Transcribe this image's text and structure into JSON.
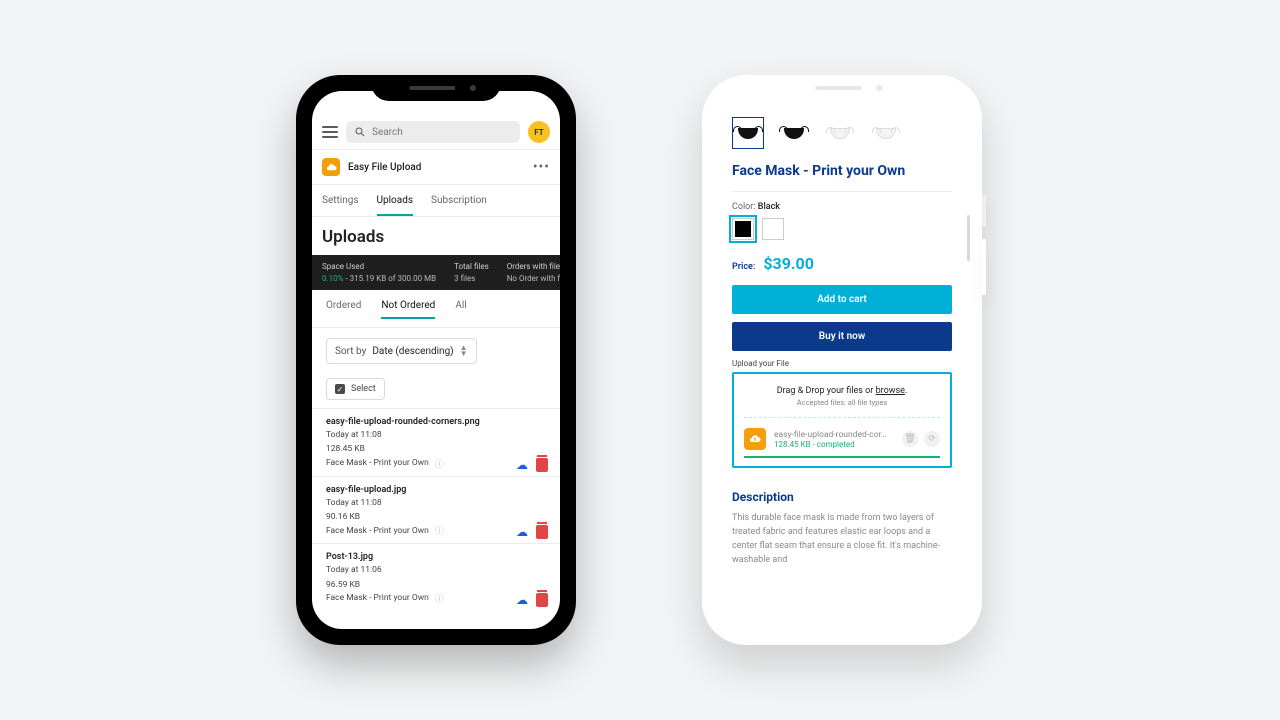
{
  "left": {
    "search_placeholder": "Search",
    "avatar_initials": "FT",
    "app_name": "Easy File Upload",
    "tabs": [
      "Settings",
      "Uploads",
      "Subscription"
    ],
    "active_tab": "Uploads",
    "page_heading": "Uploads",
    "stats": {
      "space_label": "Space Used",
      "space_pct": "0.10%",
      "space_sep": " - ",
      "space_detail": "315.19 KB of 300.00 MB",
      "files_label": "Total files",
      "files_value": "3 files",
      "orders_label": "Orders with files",
      "orders_value": "No Order with files yet"
    },
    "subtabs": [
      "Ordered",
      "Not Ordered",
      "All"
    ],
    "active_subtab": "Not Ordered",
    "sort_prefix": "Sort by ",
    "sort_value": "Date (descending)",
    "select_button": "Select",
    "files": [
      {
        "name": "easy-file-upload-rounded-corners.png",
        "when": "Today at 11:08",
        "size": "128.45 KB",
        "product": "Face Mask - Print your Own"
      },
      {
        "name": "easy-file-upload.jpg",
        "when": "Today at 11:08",
        "size": "90.16 KB",
        "product": "Face Mask - Print your Own"
      },
      {
        "name": "Post-13.jpg",
        "when": "Today at 11:06",
        "size": "96.59 KB",
        "product": "Face Mask - Print your Own"
      }
    ]
  },
  "right": {
    "product_title": "Face Mask - Print your Own",
    "color_label": "Color:",
    "color_value": "Black",
    "price_label": "Price:",
    "price_value": "$39.00",
    "add_to_cart": "Add to cart",
    "buy_now": "Buy it now",
    "upload_label": "Upload your File",
    "drop_text_a": "Drag & Drop your files or ",
    "drop_text_b": "browse",
    "drop_text_c": ".",
    "accepted_text": "Accepted files: all file types",
    "uploaded": {
      "name": "easy-file-upload-rounded-cor…",
      "status": "128.45 KB - completed"
    },
    "description_heading": "Description",
    "description_body": "This durable face mask is made from two layers of treated fabric and features elastic ear loops and a center flat seam that ensure a close fit. It's machine-washable and"
  }
}
